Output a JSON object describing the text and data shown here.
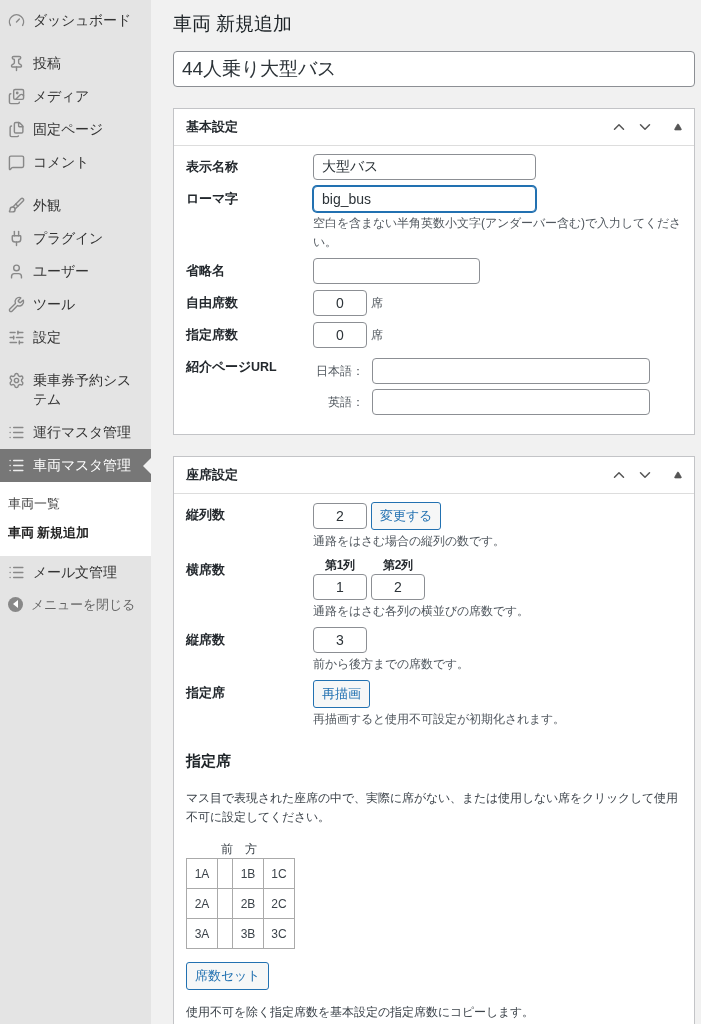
{
  "sidebar": {
    "groups": [
      [
        {
          "label": "ダッシュボード",
          "selected": false
        }
      ],
      [
        {
          "label": "投稿",
          "selected": false
        },
        {
          "label": "メディア",
          "selected": false
        },
        {
          "label": "固定ページ",
          "selected": false
        },
        {
          "label": "コメント",
          "selected": false
        }
      ],
      [
        {
          "label": "外観",
          "selected": false
        },
        {
          "label": "プラグイン",
          "selected": false
        },
        {
          "label": "ユーザー",
          "selected": false
        },
        {
          "label": "ツール",
          "selected": false
        },
        {
          "label": "設定",
          "selected": false
        }
      ],
      [
        {
          "label": "乗車券予約システム",
          "selected": false
        },
        {
          "label": "運行マスタ管理",
          "selected": false
        },
        {
          "label": "車両マスタ管理",
          "selected": true,
          "submenu": [
            {
              "label": "車両一覧",
              "selected": false
            },
            {
              "label": "車両 新規追加",
              "selected": true
            }
          ]
        },
        {
          "label": "メール文管理",
          "selected": false
        }
      ]
    ],
    "collapse": "メニューを閉じる"
  },
  "page_title": "車両 新規追加",
  "title_field": {
    "value": "44人乗り大型バス"
  },
  "basic_panel": {
    "title": "基本設定",
    "rows": [
      {
        "kind": "text",
        "label": "表示名称",
        "value": "大型バス",
        "focused": false
      },
      {
        "kind": "text",
        "label": "ローマ字",
        "value": "big_bus",
        "focused": true,
        "hint": "空白を含まない半角英数小文字(アンダーバー含む)で入力してください。"
      },
      {
        "kind": "short",
        "label": "省略名",
        "focused": false
      },
      {
        "kind": "number",
        "label": "自由席数",
        "value": "0",
        "unit": "席"
      },
      {
        "kind": "number",
        "label": "指定席数",
        "value": "0",
        "unit": "席"
      },
      {
        "kind": "urls",
        "label": "紹介ページURL",
        "fields": [
          {
            "label": "日本語："
          },
          {
            "label": "英語："
          }
        ]
      }
    ]
  },
  "seat_panel": {
    "title": "座席設定",
    "rows": [
      {
        "kind": "number_button",
        "label": "縦列数",
        "value": "2",
        "button": "変更する",
        "hint": "通路をはさむ場合の縦列の数です。"
      },
      {
        "kind": "columns",
        "label": "横席数",
        "columns": [
          {
            "header": "第1列",
            "value": "1"
          },
          {
            "header": "第2列",
            "value": "2"
          }
        ],
        "hint": "通路をはさむ各列の横並びの席数です。"
      },
      {
        "kind": "number",
        "label": "縦席数",
        "value": "3",
        "hint": "前から後方までの席数です。"
      },
      {
        "kind": "button",
        "label": "指定席",
        "button": "再描画",
        "hint": "再描画すると使用不可設定が初期化されます。"
      }
    ],
    "section_title": "指定席",
    "description": "マス目で表現された座席の中で、実際に席がない、または使用しない席をクリックして使用不可に設定してください。",
    "front_label": "前　方",
    "seat_rows": [
      {
        "left": [
          "1A"
        ],
        "right": [
          "1B",
          "1C"
        ]
      },
      {
        "left": [
          "2A"
        ],
        "right": [
          "2B",
          "2C"
        ]
      },
      {
        "left": [
          "3A"
        ],
        "right": [
          "3B",
          "3C"
        ]
      }
    ],
    "set_button": "席数セット",
    "note": "使用不可を除く指定席数を基本設定の指定席数にコピーします。"
  }
}
